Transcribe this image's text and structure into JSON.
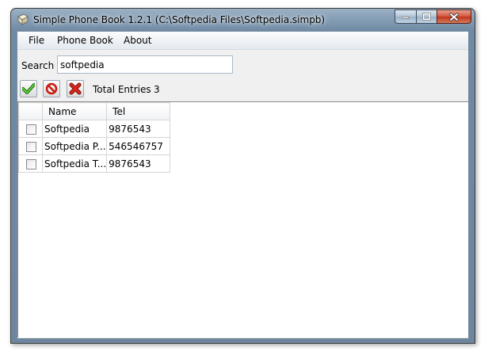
{
  "window": {
    "title": "Simple Phone Book 1.2.1 (C:\\Softpedia Files\\Softpedia.simpb)"
  },
  "menu": {
    "items": [
      {
        "label": "File"
      },
      {
        "label": "Phone Book"
      },
      {
        "label": "About"
      }
    ]
  },
  "search": {
    "label": "Search",
    "value": "softpedia"
  },
  "toolbar": {
    "icons": [
      "check-icon",
      "cancel-icon",
      "delete-icon"
    ]
  },
  "total": {
    "label": "Total Entries",
    "value": "3"
  },
  "table": {
    "columns": [
      "Name",
      "Tel"
    ],
    "rows": [
      {
        "name": "Softpedia",
        "tel": "9876543"
      },
      {
        "name": "Softpedia P...",
        "tel": "546546757"
      },
      {
        "name": "Softpedia T...",
        "tel": "9876543"
      }
    ]
  },
  "colors": {
    "titlebar": "#6f8aa5",
    "close_button": "#c0341b",
    "check_green": "#2f9a1c",
    "cancel_red": "#c8180c"
  }
}
